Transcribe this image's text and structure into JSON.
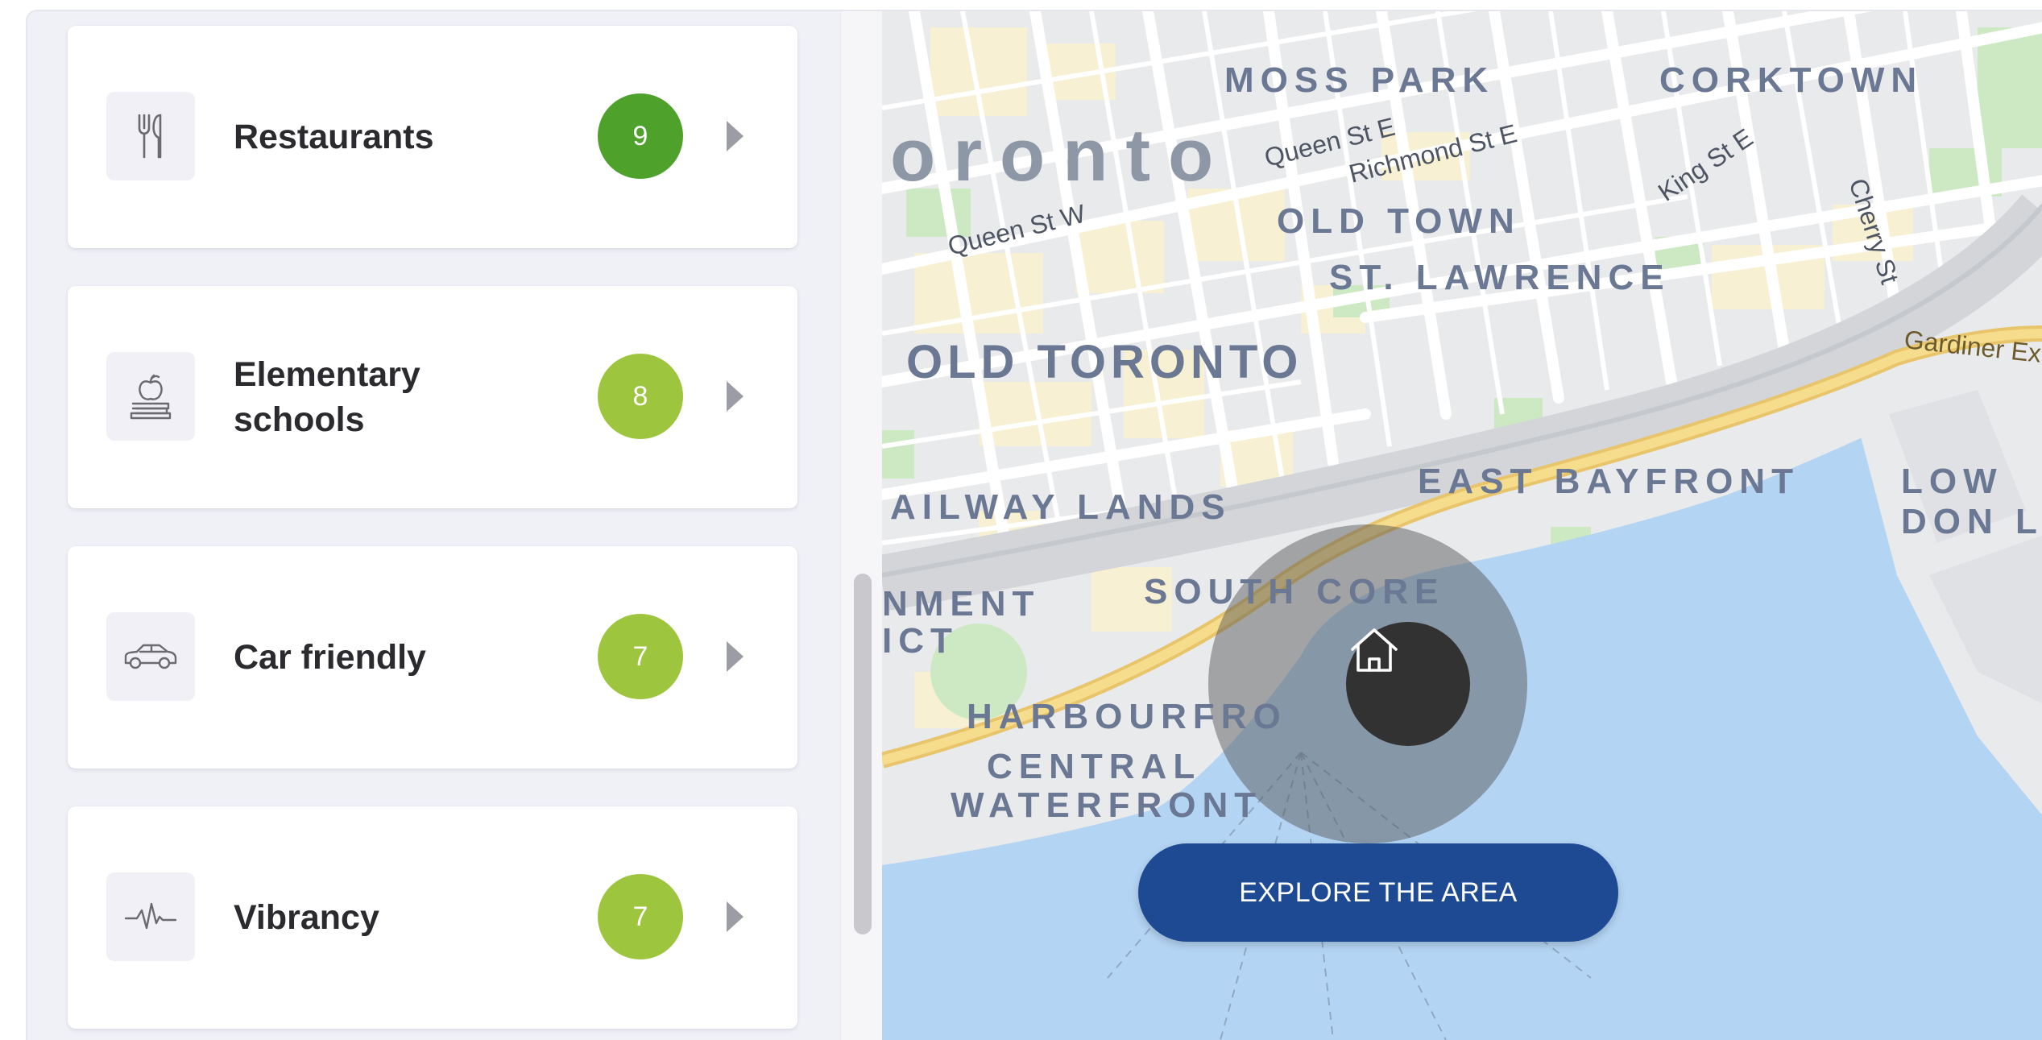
{
  "categories": [
    {
      "label": "Restaurants",
      "score": "9",
      "icon": "fork-knife-icon",
      "color": "#4ea22b"
    },
    {
      "label": "Elementary\nschools",
      "score": "8",
      "icon": "apple-books-icon",
      "color": "#9dc53e"
    },
    {
      "label": "Car friendly",
      "score": "7",
      "icon": "car-icon",
      "color": "#9dc53e"
    },
    {
      "label": "Vibrancy",
      "score": "7",
      "icon": "heartbeat-icon",
      "color": "#9dc53e"
    }
  ],
  "map": {
    "districts": [
      "MOSS PARK",
      "CORKTOWN",
      "oronto",
      "OLD TOWN",
      "ST. LAWRENCE",
      "OLD TORONTO",
      "EAST BAYFRONT",
      "AILWAY LANDS",
      "LOW",
      "DON LA",
      "SOUTH CORE",
      "NMENT",
      "ICT",
      "HARBOURFRO",
      "CENTRAL",
      "WATERFRONT"
    ],
    "streets": [
      "Queen St E",
      "Richmond St E",
      "King St E",
      "Queen St W",
      "Cherry St",
      "Gardiner Ex"
    ],
    "colors": {
      "water": "#b3d4f3",
      "land": "#e9eaec",
      "block": "#f8f0d2",
      "park": "#cde9c3",
      "highway": "#f2d47a"
    }
  },
  "explore_button_label": "EXPLORE THE AREA"
}
